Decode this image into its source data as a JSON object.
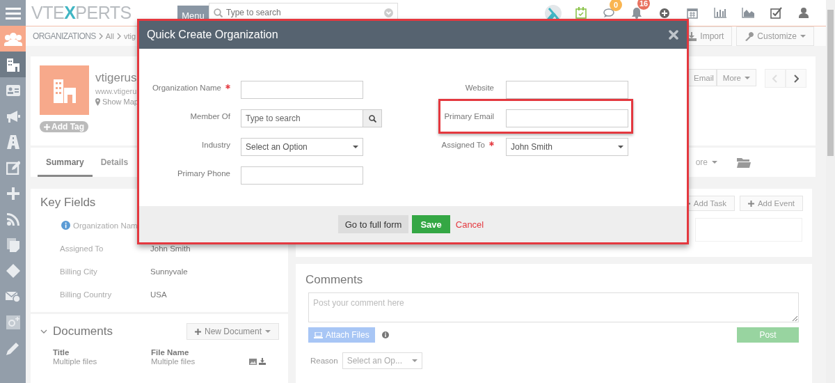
{
  "sidebar": {
    "menu": {
      "kind": "menu"
    },
    "app": {
      "kind": "people"
    },
    "items": [
      {
        "kind": "building",
        "selected": true
      },
      {
        "kind": "card",
        "selected": false
      },
      {
        "kind": "megaphone",
        "selected": false
      },
      {
        "kind": "road",
        "selected": false
      },
      {
        "kind": "edit",
        "selected": false
      },
      {
        "kind": "plus",
        "selected": false
      },
      {
        "kind": "rss",
        "selected": false
      },
      {
        "kind": "docs",
        "selected": false
      },
      {
        "kind": "diamond",
        "selected": false
      },
      {
        "kind": "mail",
        "selected": false
      },
      {
        "kind": "gplus",
        "selected": false
      },
      {
        "kind": "pencil",
        "selected": false
      }
    ]
  },
  "top_bar": {
    "logo": [
      {
        "text": "VTE",
        "accent": false
      },
      {
        "text": "X",
        "accent": true
      },
      {
        "text": "PERTS",
        "accent": false
      }
    ],
    "menu_button": "Menu",
    "search": {
      "placeholder": "Type to search"
    },
    "icons": [
      {
        "kind": "vtx"
      },
      {
        "kind": "calendar-check"
      },
      {
        "kind": "chat",
        "badge": {
          "text": "0",
          "color": "#f9b551"
        }
      },
      {
        "kind": "bell",
        "badge": {
          "text": "16",
          "color": "#e8715f"
        }
      },
      {
        "kind": "plus-circle"
      },
      {
        "kind": "calendar"
      },
      {
        "kind": "bar-chart"
      },
      {
        "kind": "area-chart"
      },
      {
        "kind": "checkbox"
      },
      {
        "kind": "user"
      }
    ]
  },
  "header": {
    "breadcrumb": [
      "ORGANIZATIONS",
      "All",
      "vtig"
    ],
    "buttons": [
      {
        "label": "Import",
        "kind": "import"
      },
      {
        "label": "Customize",
        "kind": "customize"
      }
    ]
  },
  "record": {
    "name": "vtigerus",
    "website": "www.vtigeru",
    "show_map": "Show Map",
    "add_tag": "Add Tag",
    "actions": [
      "Email",
      "More"
    ],
    "nav": [
      {
        "kind": "prev",
        "disabled": true
      },
      {
        "kind": "next",
        "disabled": false
      }
    ]
  },
  "tabs": [
    {
      "label": "Summary",
      "selected": true
    },
    {
      "label": "Details",
      "selected": false
    }
  ],
  "tabs_more": "ore",
  "key_fields": {
    "title": "Key Fields",
    "rows": [
      {
        "label": "Organization Nam",
        "info": true
      },
      {
        "label": "Assigned To",
        "value": "John Smith",
        "info": false
      },
      {
        "label": "Billing City",
        "value": "Sunnyvale",
        "info": false
      },
      {
        "label": "Billing Country",
        "value": "USA",
        "info": false
      }
    ]
  },
  "documents": {
    "title": "Documents",
    "new_button": "New Document",
    "columns": [
      "Title",
      "File Name"
    ],
    "rows": [
      [
        "Multiple files",
        "Multiple files"
      ]
    ]
  },
  "activities": {
    "buttons": [
      "Add Task",
      "Add Event"
    ]
  },
  "comments": {
    "title": "Comments",
    "placeholder": "Post your comment here",
    "attach_button": "Attach Files",
    "post_button": "Post",
    "reason_label": "Reason",
    "reason_select": "Select an Op..."
  },
  "modal": {
    "title": "Quick Create Organization",
    "left_fields": [
      {
        "label": "Organization Name",
        "required": true,
        "kind": "input"
      },
      {
        "label": "Member Of",
        "required": false,
        "kind": "lookup",
        "placeholder": "Type to search"
      },
      {
        "label": "Industry",
        "required": false,
        "kind": "select",
        "value": "Select an Option"
      },
      {
        "label": "Primary Phone",
        "required": false,
        "kind": "input"
      }
    ],
    "right_fields": [
      {
        "label": "Website",
        "required": false,
        "kind": "input",
        "highlighted": false
      },
      {
        "label": "Primary Email",
        "required": false,
        "kind": "input",
        "highlighted": true
      },
      {
        "label": "Assigned To",
        "required": true,
        "kind": "select",
        "value": "John Smith",
        "highlighted": false
      }
    ],
    "footer": {
      "full_form": "Go to full form",
      "save": "Save",
      "cancel": "Cancel"
    }
  }
}
